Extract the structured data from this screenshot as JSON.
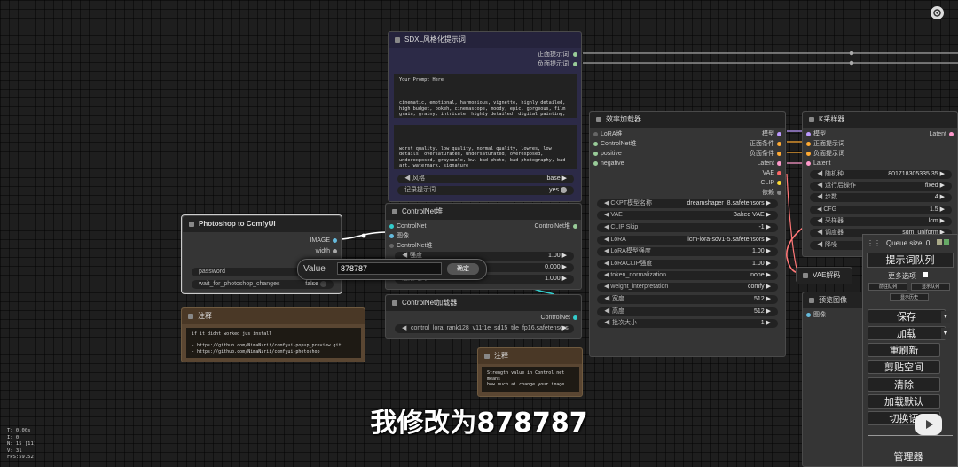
{
  "sdxl_node": {
    "title": "SDXL风格化提示词",
    "out_positive": "正面提示词",
    "out_negative": "负面提示词",
    "positive_text": "Your Prompt Here\n\n\n\ncinematic, emotional, harmonious, vignette, highly detailed, high budget, bokeh, cinemascope, moody, epic, gorgeous, film grain, grainy, intricate, highly detailed, digital painting, artstation, concept art, sharp focus, cinematic lighting",
    "negative_text": "\n\n\nworst quality, low quality, normal quality, lowres, low details, oversaturated, undersaturated, overexposed, underexposed, grayscale, bw, bad photo, bad photography, bad art, watermark, signature",
    "style_label": "风格",
    "style_value": "base",
    "log_label": "记录提示词",
    "log_value": "yes"
  },
  "controlnet_stack": {
    "title": "ControlNet堆",
    "in_controlnet": "ControlNet",
    "in_image": "图像",
    "in_controlnet_stack": "ControlNet堆",
    "out_controlnet": "ControlNet堆",
    "strength_label": "强度",
    "strength_value": "1.00",
    "start_value": "0.000",
    "end_label": "结束时间",
    "end_value": "1.000"
  },
  "controlnet_loader": {
    "title": "ControlNet加载器",
    "out": "ControlNet",
    "model_value": "control_lora_rank128_v11f1e_sd15_tile_fp16.safetensors"
  },
  "ps_node": {
    "title": "Photoshop to ComfyUI",
    "out_image": "IMAGE",
    "out_width": "width",
    "password_label": "password",
    "wait_label": "wait_for_photoshop_changes",
    "wait_value": "false"
  },
  "value_dialog": {
    "label": "Value",
    "input_value": "878787",
    "confirm": "确定"
  },
  "note1": {
    "title": "注释",
    "text": "if it didnt worked jus install\n\n- https://github.com/NimaNzrii/comfyui-popup_preview.git\n- https://github.com/NimaNzrii/comfyui-photoshop"
  },
  "note2": {
    "title": "注释",
    "text": "Strength value in Control net means\nhow much ai change your image."
  },
  "efficiency_loader": {
    "title": "效率加载器",
    "inputs": [
      "LoRA堆",
      "ControlNet堆",
      "positive",
      "negative"
    ],
    "outputs": [
      "模型",
      "正面条件",
      "负面条件",
      "Latent",
      "VAE",
      "CLIP",
      "依赖"
    ],
    "widgets": [
      {
        "label": "CKPT模型名称",
        "value": "dreamshaper_8.safetensors"
      },
      {
        "label": "VAE",
        "value": "Baked VAE"
      },
      {
        "label": "CLIP Skip",
        "value": "-1"
      },
      {
        "label": "LoRA",
        "value": "lcm-lora-sdv1-5.safetensors"
      },
      {
        "label": "LoRA模型强度",
        "value": "1.00"
      },
      {
        "label": "LoRACLIP强度",
        "value": "1.00"
      },
      {
        "label": "token_normalization",
        "value": "none"
      },
      {
        "label": "weight_interpretation",
        "value": "comfy"
      },
      {
        "label": "宽度",
        "value": "512"
      },
      {
        "label": "高度",
        "value": "512"
      },
      {
        "label": "批次大小",
        "value": "1"
      }
    ]
  },
  "ksampler": {
    "title": "K采样器",
    "inputs": [
      "模型",
      "正面提示词",
      "负面提示词",
      "Latent"
    ],
    "output": "Latent",
    "widgets": [
      {
        "label": "随机种",
        "value": "801718305335 35"
      },
      {
        "label": "运行后操作",
        "value": "fixed"
      },
      {
        "label": "步数",
        "value": "4"
      },
      {
        "label": "CFG",
        "value": "1.5"
      },
      {
        "label": "采样器",
        "value": "lcm"
      },
      {
        "label": "调度器",
        "value": "sgm_uniform"
      },
      {
        "label": "降噪",
        "value": ""
      }
    ]
  },
  "vae_decode": {
    "title": "VAE解码"
  },
  "preview": {
    "title": "预览图像",
    "in_image": "图像"
  },
  "queue_panel": {
    "queue_size": "Queue size: 0",
    "queue_prompt": "提示词队列",
    "more_options": "更多选项",
    "small": [
      "前往队列",
      "显示队列"
    ],
    "history": "显示历史",
    "buttons": [
      "保存",
      "加载",
      "重刷新",
      "剪贴空间",
      "清除",
      "加载默认",
      "切换语"
    ],
    "manager": "管理器"
  },
  "stats": {
    "t": "T: 0.00s",
    "i": "I: 0",
    "n": "N: 15 [11]",
    "v": "V: 31",
    "fps": "FPS:59.52"
  },
  "subtitle": "我修改为878787"
}
